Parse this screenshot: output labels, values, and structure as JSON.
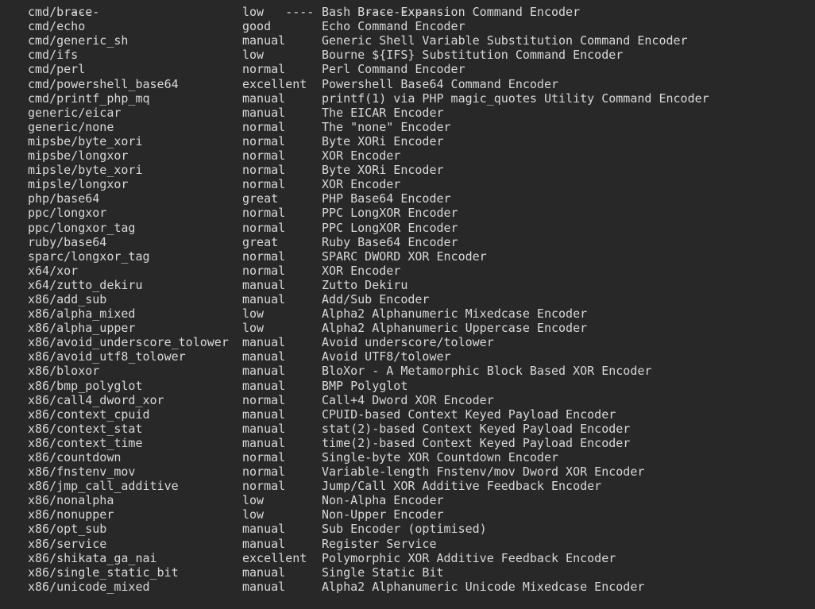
{
  "terminal": {
    "background_color": "#282828",
    "text_color": "#d8d8d8",
    "header_separator": {
      "name": "----",
      "rank": "----",
      "description": "-----------"
    },
    "rows": [
      {
        "name": "cmd/brace",
        "rank": "low",
        "description": "Bash Brace Expansion Command Encoder"
      },
      {
        "name": "cmd/echo",
        "rank": "good",
        "description": "Echo Command Encoder"
      },
      {
        "name": "cmd/generic_sh",
        "rank": "manual",
        "description": "Generic Shell Variable Substitution Command Encoder"
      },
      {
        "name": "cmd/ifs",
        "rank": "low",
        "description": "Bourne ${IFS} Substitution Command Encoder"
      },
      {
        "name": "cmd/perl",
        "rank": "normal",
        "description": "Perl Command Encoder"
      },
      {
        "name": "cmd/powershell_base64",
        "rank": "excellent",
        "description": "Powershell Base64 Command Encoder"
      },
      {
        "name": "cmd/printf_php_mq",
        "rank": "manual",
        "description": "printf(1) via PHP magic_quotes Utility Command Encoder"
      },
      {
        "name": "generic/eicar",
        "rank": "manual",
        "description": "The EICAR Encoder"
      },
      {
        "name": "generic/none",
        "rank": "normal",
        "description": "The \"none\" Encoder"
      },
      {
        "name": "mipsbe/byte_xori",
        "rank": "normal",
        "description": "Byte XORi Encoder"
      },
      {
        "name": "mipsbe/longxor",
        "rank": "normal",
        "description": "XOR Encoder"
      },
      {
        "name": "mipsle/byte_xori",
        "rank": "normal",
        "description": "Byte XORi Encoder"
      },
      {
        "name": "mipsle/longxor",
        "rank": "normal",
        "description": "XOR Encoder"
      },
      {
        "name": "php/base64",
        "rank": "great",
        "description": "PHP Base64 Encoder"
      },
      {
        "name": "ppc/longxor",
        "rank": "normal",
        "description": "PPC LongXOR Encoder"
      },
      {
        "name": "ppc/longxor_tag",
        "rank": "normal",
        "description": "PPC LongXOR Encoder"
      },
      {
        "name": "ruby/base64",
        "rank": "great",
        "description": "Ruby Base64 Encoder"
      },
      {
        "name": "sparc/longxor_tag",
        "rank": "normal",
        "description": "SPARC DWORD XOR Encoder"
      },
      {
        "name": "x64/xor",
        "rank": "normal",
        "description": "XOR Encoder"
      },
      {
        "name": "x64/zutto_dekiru",
        "rank": "manual",
        "description": "Zutto Dekiru"
      },
      {
        "name": "x86/add_sub",
        "rank": "manual",
        "description": "Add/Sub Encoder"
      },
      {
        "name": "x86/alpha_mixed",
        "rank": "low",
        "description": "Alpha2 Alphanumeric Mixedcase Encoder"
      },
      {
        "name": "x86/alpha_upper",
        "rank": "low",
        "description": "Alpha2 Alphanumeric Uppercase Encoder"
      },
      {
        "name": "x86/avoid_underscore_tolower",
        "rank": "manual",
        "description": "Avoid underscore/tolower"
      },
      {
        "name": "x86/avoid_utf8_tolower",
        "rank": "manual",
        "description": "Avoid UTF8/tolower"
      },
      {
        "name": "x86/bloxor",
        "rank": "manual",
        "description": "BloXor - A Metamorphic Block Based XOR Encoder"
      },
      {
        "name": "x86/bmp_polyglot",
        "rank": "manual",
        "description": "BMP Polyglot"
      },
      {
        "name": "x86/call4_dword_xor",
        "rank": "normal",
        "description": "Call+4 Dword XOR Encoder"
      },
      {
        "name": "x86/context_cpuid",
        "rank": "manual",
        "description": "CPUID-based Context Keyed Payload Encoder"
      },
      {
        "name": "x86/context_stat",
        "rank": "manual",
        "description": "stat(2)-based Context Keyed Payload Encoder"
      },
      {
        "name": "x86/context_time",
        "rank": "manual",
        "description": "time(2)-based Context Keyed Payload Encoder"
      },
      {
        "name": "x86/countdown",
        "rank": "normal",
        "description": "Single-byte XOR Countdown Encoder"
      },
      {
        "name": "x86/fnstenv_mov",
        "rank": "normal",
        "description": "Variable-length Fnstenv/mov Dword XOR Encoder"
      },
      {
        "name": "x86/jmp_call_additive",
        "rank": "normal",
        "description": "Jump/Call XOR Additive Feedback Encoder"
      },
      {
        "name": "x86/nonalpha",
        "rank": "low",
        "description": "Non-Alpha Encoder"
      },
      {
        "name": "x86/nonupper",
        "rank": "low",
        "description": "Non-Upper Encoder"
      },
      {
        "name": "x86/opt_sub",
        "rank": "manual",
        "description": "Sub Encoder (optimised)"
      },
      {
        "name": "x86/service",
        "rank": "manual",
        "description": "Register Service"
      },
      {
        "name": "x86/shikata_ga_nai",
        "rank": "excellent",
        "description": "Polymorphic XOR Additive Feedback Encoder"
      },
      {
        "name": "x86/single_static_bit",
        "rank": "manual",
        "description": "Single Static Bit"
      },
      {
        "name": "x86/unicode_mixed",
        "rank": "manual",
        "description": "Alpha2 Alphanumeric Unicode Mixedcase Encoder"
      }
    ]
  }
}
